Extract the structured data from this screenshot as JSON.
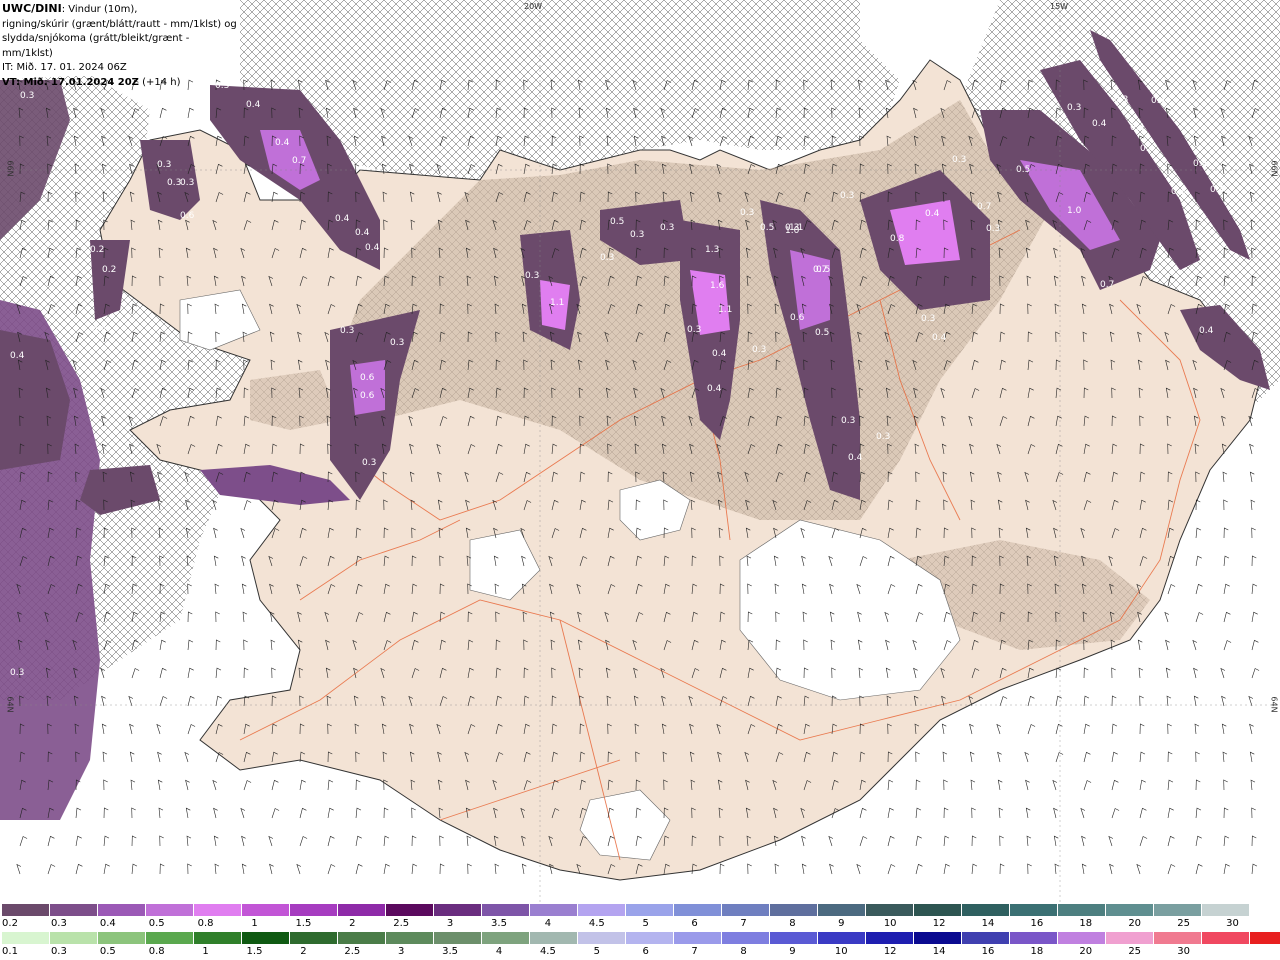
{
  "header": {
    "brand": "UWC/DINI",
    "line1_rest": ": Vindur (10m),",
    "line2": "rigning/skúrir (grænt/blátt/rautt - mm/1klst) og",
    "line3": "slydda/snjókoma (grátt/bleikt/grænt - mm/1klst)",
    "line4": "IT: Mið. 17. 01. 2024 06Z",
    "vt_bold": "VT: Mið. 17.01.2024 20Z",
    "vt_rest": " (+14 h)"
  },
  "graticule": {
    "lon_labels": [
      "20W",
      "15W"
    ],
    "lat_labels": [
      "66N",
      "66N",
      "64N",
      "64N"
    ]
  },
  "map_labels": [
    "0.3",
    "0.3",
    "0.4",
    "0.4",
    "0.7",
    "0.6",
    "0.3",
    "0.3",
    "0.3",
    "0.4",
    "0.4",
    "0.4",
    "0.2",
    "0.2",
    "0.3",
    "0.3",
    "0.6",
    "0.6",
    "0.3",
    "0.3",
    "0.5",
    "0.3",
    "0.3",
    "0.3",
    "0.3",
    "0.3",
    "0.3",
    "0.4",
    "0.3",
    "1.1",
    "0.5",
    "0.3",
    "1.3",
    "1.6",
    "1.1",
    "0.3",
    "0.4",
    "1.1",
    "0.5",
    "1.0",
    "0.7",
    "0.6",
    "0.5",
    "0.3",
    "0.4",
    "0.3",
    "0.3",
    "0.4",
    "0.8",
    "0.7",
    "0.3",
    "0.3",
    "0.4",
    "0.5",
    "1.0",
    "0.7",
    "0.4",
    "0.3",
    "0.4",
    "0.4",
    "0.4",
    "0.3",
    "0.4",
    "0.3",
    "0.4",
    "0.4",
    "0.4",
    "0.3"
  ],
  "legend_snow": {
    "colors": [
      "#6b4a6b",
      "#7d4e8a",
      "#9b59b6",
      "#c070d8",
      "#e07ef0",
      "#c255d6",
      "#a63cc0",
      "#8e2aa8",
      "#5b0a5e",
      "#6a2d7f",
      "#7e55a8",
      "#9a7fd0",
      "#b4a4f0",
      "#9aa3ea",
      "#8090d8",
      "#6f7fc0",
      "#5f6f9e",
      "#4c6a80",
      "#3a5a5c",
      "#2d5551",
      "#2f6060",
      "#3b7073",
      "#4d7f80",
      "#5f8f90",
      "#7a9fa0",
      "#c6d2d2"
    ],
    "ticks": [
      "0.2",
      "0.3",
      "0.4",
      "0.5",
      "0.8",
      "1",
      "1.5",
      "2",
      "2.5",
      "3",
      "3.5",
      "4",
      "4.5",
      "5",
      "6",
      "7",
      "8",
      "9",
      "10",
      "12",
      "14",
      "16",
      "18",
      "20",
      "25",
      "30"
    ]
  },
  "legend_rain": {
    "colors": [
      "#d8f5d0",
      "#b9e2aa",
      "#8cc47c",
      "#5aa84e",
      "#2f7f2a",
      "#0f5a12",
      "#2e6b2e",
      "#4a7c48",
      "#5d8a5c",
      "#6c8f6b",
      "#7ea37e",
      "#a2b8b0",
      "#c2c2e8",
      "#b4b4ef",
      "#9a9aea",
      "#7e7ee0",
      "#5a5ad4",
      "#3a3ac4",
      "#1e1eb0",
      "#0a0a90",
      "#4040b0",
      "#7a56c8",
      "#c080e0",
      "#f0a0d0",
      "#f07a90",
      "#f04860",
      "#e82020"
    ],
    "ticks": [
      "0.1",
      "0.3",
      "0.5",
      "0.8",
      "1",
      "1.5",
      "2",
      "2.5",
      "3",
      "3.5",
      "4",
      "4.5",
      "5",
      "6",
      "7",
      "8",
      "9",
      "10",
      "12",
      "14",
      "16",
      "18",
      "20",
      "25",
      "30"
    ]
  }
}
